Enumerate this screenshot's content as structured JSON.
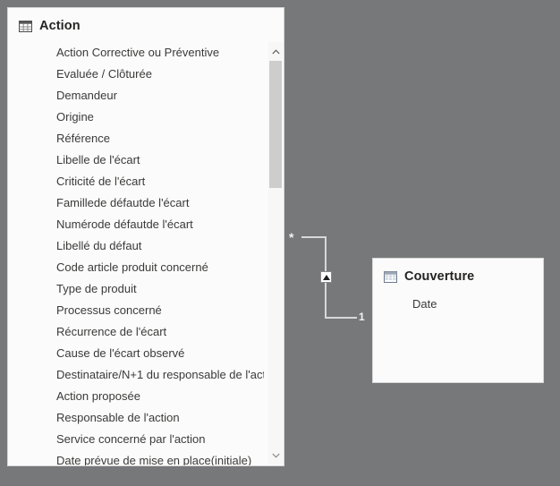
{
  "canvas": {
    "background_color": "#77787a"
  },
  "tables": [
    {
      "id": "action",
      "name": "Action",
      "icon": "table-icon",
      "fields": [
        "Action Corrective ou Préventive",
        "Evaluée / Clôturée",
        "Demandeur",
        "Origine",
        "Référence",
        "Libelle de l'écart",
        "Criticité de l'écart",
        "Famillede défautde l'écart",
        "Numérode défautde l'écart",
        "Libellé du défaut",
        "Code article produit concerné",
        "Type de produit",
        "Processus concerné",
        "Récurrence de l'écart",
        "Cause de l'écart observé",
        "Destinataire/N+1 du responsable de l'act",
        "Action proposée",
        "Responsable de l'action",
        "Service concerné par l'action",
        "Date prévue de mise en place(initiale)"
      ],
      "scrollbar": {
        "up_arrow": "chevron-up-icon",
        "down_arrow": "chevron-down-icon"
      }
    },
    {
      "id": "couverture",
      "name": "Couverture",
      "icon": "table-icon",
      "fields": [
        "Date"
      ]
    }
  ],
  "relationship": {
    "from_cardinality": "*",
    "to_cardinality": "1",
    "cross_filter_direction_icon": "filter-direction-arrow-icon"
  }
}
